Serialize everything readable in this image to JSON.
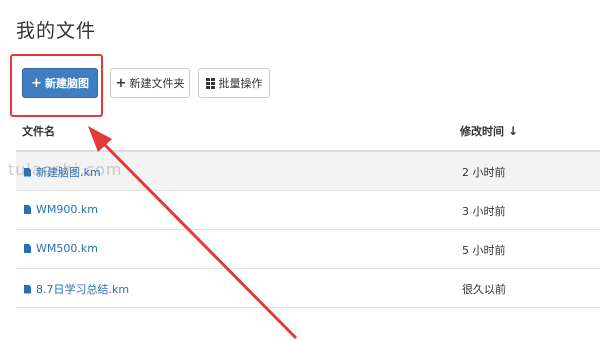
{
  "page": {
    "title": "我的文件"
  },
  "toolbar": {
    "new_mindmap_label": "新建脑图",
    "new_folder_label": "新建文件夹",
    "batch_label": "批量操作"
  },
  "table": {
    "col_name": "文件名",
    "col_time": "修改时间",
    "sort_symbol": "↓",
    "rows": [
      {
        "name": "新建脑图.km",
        "time": "2 小时前"
      },
      {
        "name": "WM900.km",
        "time": "3 小时前"
      },
      {
        "name": "WM500.km",
        "time": "5 小时前"
      },
      {
        "name": "8.7日学习总结.km",
        "time": "很久以前"
      }
    ]
  },
  "watermark": "tulaoshi.com",
  "colors": {
    "primary": "#3f7fc1",
    "link": "#2a6fb7",
    "annotation": "#e53935"
  },
  "icons": {
    "new_mindmap": "plus-icon",
    "new_folder": "plus-icon",
    "batch": "grid-icon",
    "file": "file-icon",
    "sort": "arrow-down-icon"
  }
}
